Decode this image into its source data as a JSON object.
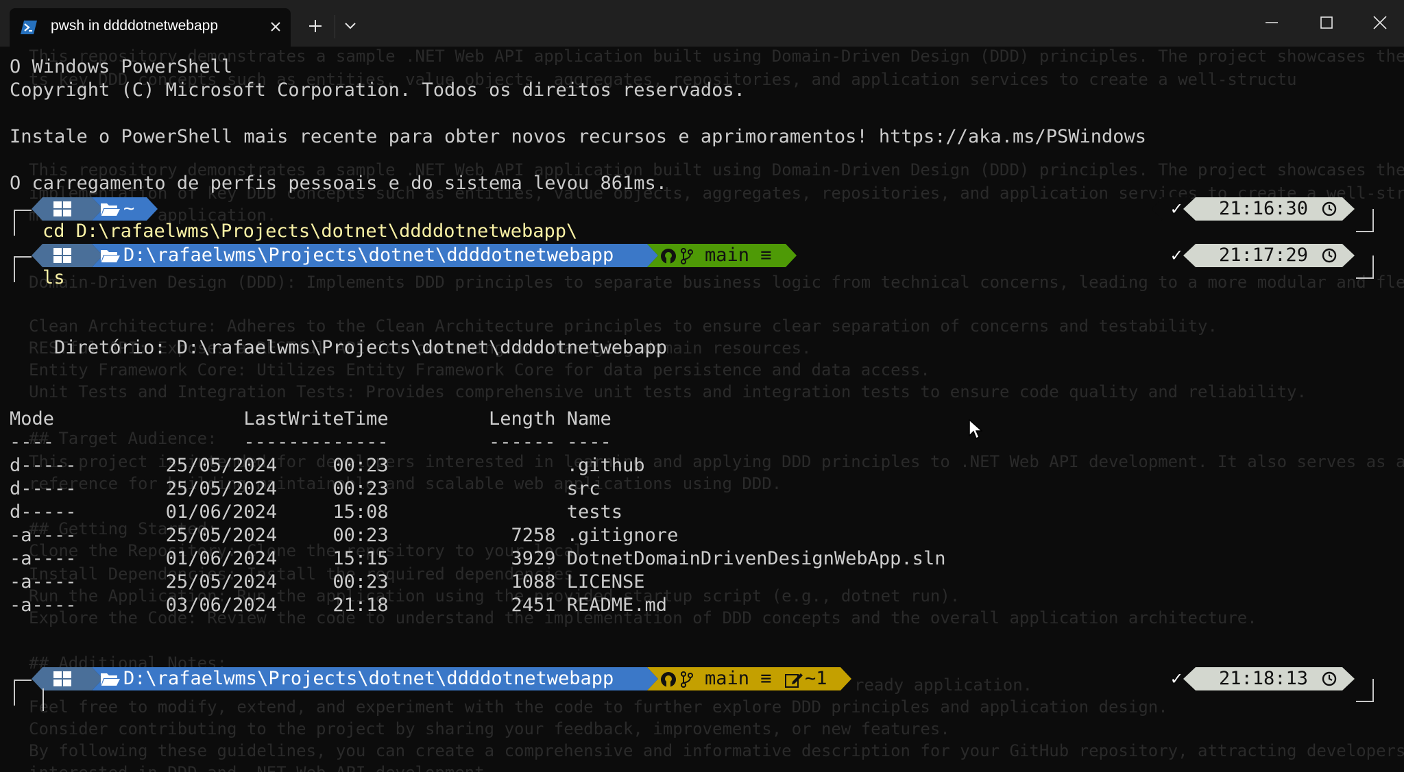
{
  "window": {
    "tab_title": "pwsh in ddddotnetwebapp",
    "icons": {
      "tab": "powershell-icon",
      "close": "close-icon",
      "new_tab": "plus-icon",
      "dropdown": "chevron-down-icon",
      "minimize": "minimize-icon",
      "maximize": "maximize-icon",
      "window_close": "close-icon"
    }
  },
  "ghost_text": [
    "This repository demonstrates a sample .NET Web API application built using Domain-Driven Design (DDD) principles. The project showcases the",
    "ts key DDD concepts such as entities, value objects, aggregates, repositories, and application services to create a well-structu",
    "This repository demonstrates a sample .NET Web API application built using Domain-Driven Design (DDD) principles. The project showcases the",
    "implementation of key DDD concepts such as entities, value objects, aggregates, repositories, and application services to create a well-structu",
    "maintainable application.",
    "Domain-Driven Design (DDD): Implements DDD principles to separate business logic from technical concerns, leading to a more modular and fle",
    "Clean Architecture: Adheres to the Clean Architecture principles to ensure clear separation of concerns and testability.",
    "RESTful API: Exposes a RESTful API for consuming and managing domain resources.",
    "Entity Framework Core: Utilizes Entity Framework Core for data persistence and data access.",
    "Unit Tests and Integration Tests: Provides comprehensive unit tests and integration tests to ensure code quality and reliability.",
    "## Target Audience:",
    "This project is intended for developers interested in learning and applying DDD principles to .NET Web API development. It also serves as a",
    "reference for building maintainable and scalable web applications using DDD.",
    "## Getting Started:",
    "Clone the Repository: Clone the repository to your local",
    "Install Dependencies: Install the required dependencies",
    "Run the Application: Run the application using the provided startup script (e.g., dotnet run).",
    "Explore the Code: Review the code to understand the implementation of DDD concepts and the overall application architecture.",
    "## Additional Notes:",
    "ready application.",
    "Feel free to modify, extend, and experiment with the code to further explore DDD principles and application design.",
    "Consider contributing to the project by sharing your feedback, improvements, or new features.",
    "By following these guidelines, you can create a comprehensive and informative description for your GitHub repository, attracting developers",
    "interested in DDD and .NET Web API development."
  ],
  "terminal": {
    "banner_1": "O Windows PowerShell",
    "banner_2": "Copyright (C) Microsoft Corporation. Todos os direitos reservados.",
    "banner_3": "Instale o PowerShell mais recente para obter novos recursos e aprimoramentos! https://aka.ms/PSWindows",
    "banner_4": "O carregamento de perfis pessoais e do sistema levou 861ms.",
    "prompts": [
      {
        "path": "~",
        "cmd": "cd D:\\rafaelwms\\Projects\\dotnet\\ddddotnetwebapp\\",
        "time": "21:16:30",
        "status": "✓"
      },
      {
        "path": "D:\\rafaelwms\\Projects\\dotnet\\ddddotnetwebapp",
        "git": "main ≡",
        "cmd": "ls",
        "time": "21:17:29",
        "status": "✓"
      },
      {
        "path": "D:\\rafaelwms\\Projects\\dotnet\\ddddotnetwebapp",
        "git": "main ≡",
        "git_changes": "~1",
        "cmd": "",
        "time": "21:18:13",
        "status": "✓"
      }
    ],
    "directory_label": "    Diretório: D:\\rafaelwms\\Projects\\dotnet\\ddddotnetwebapp",
    "listing": {
      "header": "Mode                 LastWriteTime         Length Name",
      "underline": "----                 -------------         ------ ----",
      "rows": [
        "d-----        25/05/2024     00:23                .github",
        "d-----        25/05/2024     00:23                src",
        "d-----        01/06/2024     15:08                tests",
        "-a----        25/05/2024     00:23           7258 .gitignore",
        "-a----        01/06/2024     15:15           3929 DotnetDomainDrivenDesignWebApp.sln",
        "-a----        25/05/2024     00:23           1088 LICENSE",
        "-a----        03/06/2024     21:18           2451 README.md"
      ]
    }
  },
  "colors": {
    "background": "#0c0c0c",
    "os_segment": "#4a6f99",
    "path_segment": "#3b78c8",
    "git_clean": "#4e9a06",
    "git_dirty": "#c4a000",
    "time_segment": "#d3d7cf",
    "command": "#f9f1a5"
  }
}
